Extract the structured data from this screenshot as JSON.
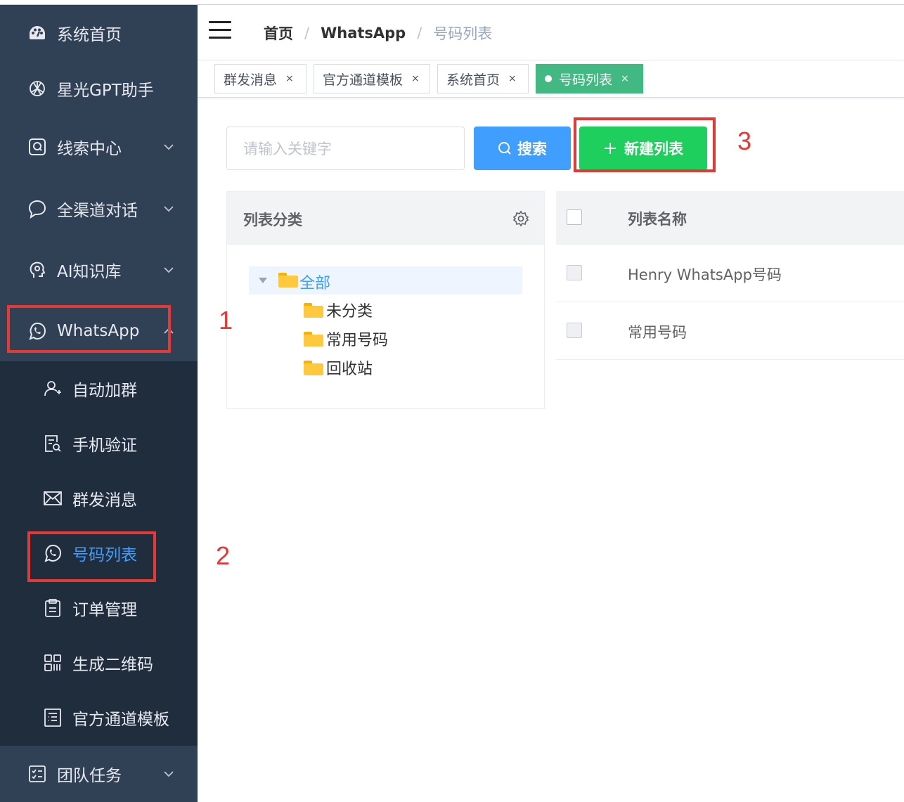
{
  "sidebar": {
    "items": [
      {
        "label": "系统首页",
        "icon": "dashboard-icon"
      },
      {
        "label": "星光GPT助手",
        "icon": "openai-icon"
      },
      {
        "label": "线索中心",
        "icon": "leads-icon"
      },
      {
        "label": "全渠道对话",
        "icon": "chat-bubble-icon"
      },
      {
        "label": "AI知识库",
        "icon": "ai-head-icon"
      },
      {
        "label": "WhatsApp",
        "icon": "whatsapp-icon"
      },
      {
        "label": "团队任务",
        "icon": "task-list-icon"
      }
    ],
    "whatsapp_submenu": [
      {
        "label": "自动加群",
        "icon": "user-add-icon"
      },
      {
        "label": "手机验证",
        "icon": "verify-doc-icon"
      },
      {
        "label": "群发消息",
        "icon": "mail-icon"
      },
      {
        "label": "号码列表",
        "icon": "whatsapp-icon",
        "active": true
      },
      {
        "label": "订单管理",
        "icon": "clipboard-icon"
      },
      {
        "label": "生成二维码",
        "icon": "qrcode-icon"
      },
      {
        "label": "官方通道模板",
        "icon": "template-icon"
      }
    ]
  },
  "breadcrumb": [
    "首页",
    "WhatsApp",
    "号码列表"
  ],
  "tags": [
    {
      "label": "群发消息",
      "close": "×"
    },
    {
      "label": "官方通道模板",
      "close": "×"
    },
    {
      "label": "系统首页",
      "close": "×"
    },
    {
      "label": "号码列表",
      "close": "×",
      "active": true
    }
  ],
  "toolbar": {
    "search_placeholder": "请输入关键字",
    "search_button": "搜索",
    "new_button": "新建列表"
  },
  "category_panel": {
    "title": "列表分类",
    "tree": {
      "root": "全部",
      "children": [
        "未分类",
        "常用号码",
        "回收站"
      ]
    }
  },
  "table": {
    "header": "列表名称",
    "rows": [
      "Henry WhatsApp号码",
      "常用号码"
    ]
  },
  "annotations": [
    "1",
    "2",
    "3"
  ],
  "colors": {
    "sidebar_bg": "#304156",
    "submenu_bg": "#1f2d3d",
    "active_text": "#409eff",
    "tag_active": "#42b983",
    "search_button": "#409eff",
    "new_button": "#1fcf5d",
    "annotation": "#e53935"
  }
}
